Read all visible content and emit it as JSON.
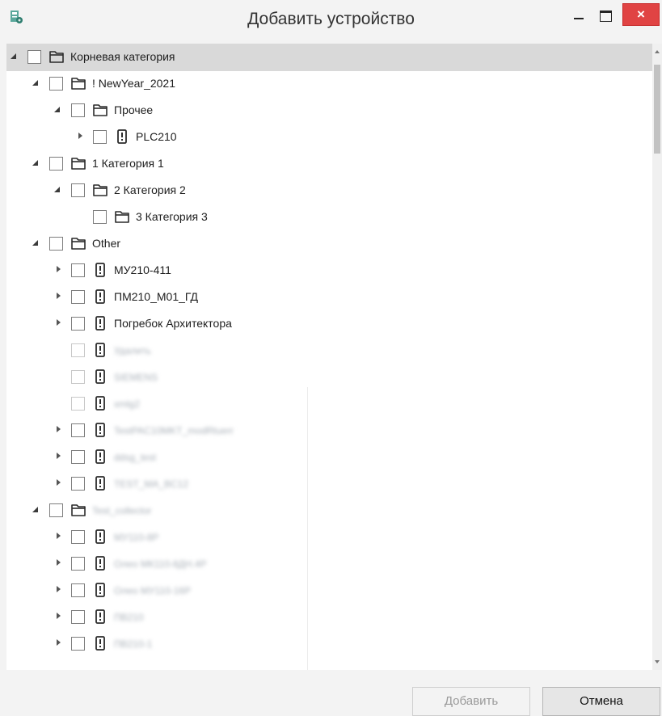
{
  "window": {
    "title": "Добавить устройство",
    "close_glyph": "×",
    "icons": {
      "app": "device-app-icon",
      "minimize": "minimize-icon",
      "maximize": "maximize-icon",
      "close": "close-icon"
    }
  },
  "colors": {
    "selection": "#d9d9d9",
    "close_button": "#e04343",
    "disabled_text": "#9a9a9a"
  },
  "tree": {
    "rows": [
      {
        "label": "Корневая категория",
        "kind": "folder",
        "expander": "open",
        "level": 0,
        "selected": true
      },
      {
        "label": "! NewYear_2021",
        "kind": "folder",
        "expander": "open",
        "level": 1
      },
      {
        "label": "Прочее",
        "kind": "folder",
        "expander": "open",
        "level": 2
      },
      {
        "label": "PLC210",
        "kind": "device",
        "expander": "closed",
        "level": 3
      },
      {
        "label": "1 Категория 1",
        "kind": "folder",
        "expander": "open",
        "level": 1
      },
      {
        "label": "2 Категория 2",
        "kind": "folder",
        "expander": "open",
        "level": 2
      },
      {
        "label": "3 Категория 3",
        "kind": "folder",
        "expander": "none",
        "level": 3
      },
      {
        "label": "Other",
        "kind": "folder",
        "expander": "open",
        "level": 1
      },
      {
        "label": "МУ210-411",
        "kind": "device",
        "expander": "closed",
        "level": 2
      },
      {
        "label": "ПМ210_М01_ГД",
        "kind": "device",
        "expander": "closed",
        "level": 2
      },
      {
        "label": "Погребок Архитектора",
        "kind": "device",
        "expander": "closed",
        "level": 2
      },
      {
        "label": "Удалить",
        "kind": "device",
        "expander": "none",
        "level": 2,
        "blurred": true,
        "disabled": true
      },
      {
        "label": "SIEMENS",
        "kind": "device",
        "expander": "none",
        "level": 2,
        "blurred": true,
        "disabled": true
      },
      {
        "label": "xmlg2",
        "kind": "device",
        "expander": "none",
        "level": 2,
        "blurred": true,
        "disabled": true
      },
      {
        "label": "TestPAC10MKT_modRtuerr",
        "kind": "device",
        "expander": "closed",
        "level": 2,
        "blurred": true
      },
      {
        "label": "ddsg_test",
        "kind": "device",
        "expander": "closed",
        "level": 2,
        "blurred": true
      },
      {
        "label": "TEST_MA_BC12",
        "kind": "device",
        "expander": "closed",
        "level": 2,
        "blurred": true
      },
      {
        "label": "Test_collector",
        "kind": "folder",
        "expander": "open",
        "level": 1,
        "blurred": true
      },
      {
        "label": "МУ110-8Р",
        "kind": "device",
        "expander": "closed",
        "level": 2,
        "blurred": true
      },
      {
        "label": "Олео МК110-8ДН.4Р",
        "kind": "device",
        "expander": "closed",
        "level": 2,
        "blurred": true
      },
      {
        "label": "Олео МУ110-16Р",
        "kind": "device",
        "expander": "closed",
        "level": 2,
        "blurred": true
      },
      {
        "label": "ПВ210",
        "kind": "device",
        "expander": "closed",
        "level": 2,
        "blurred": true
      },
      {
        "label": "ПВ210-1",
        "kind": "device",
        "expander": "closed",
        "level": 2,
        "blurred": true
      }
    ]
  },
  "footer": {
    "add_label": "Добавить",
    "cancel_label": "Отмена"
  }
}
